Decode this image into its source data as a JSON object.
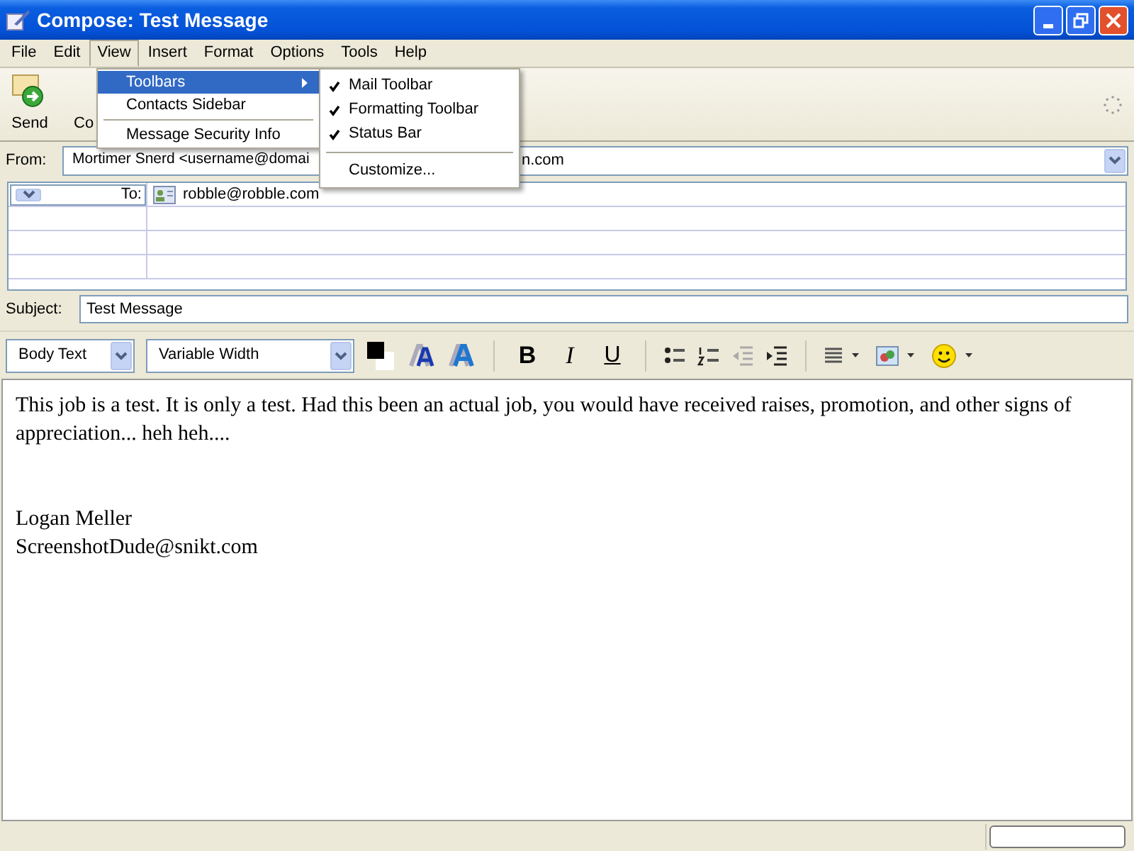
{
  "window": {
    "title": "Compose: Test Message"
  },
  "menu_bar": [
    {
      "label": "File",
      "selected": false
    },
    {
      "label": "Edit",
      "selected": false
    },
    {
      "label": "View",
      "selected": true
    },
    {
      "label": "Insert",
      "selected": false
    },
    {
      "label": "Format",
      "selected": false
    },
    {
      "label": "Options",
      "selected": false
    },
    {
      "label": "Tools",
      "selected": false
    },
    {
      "label": "Help",
      "selected": false
    }
  ],
  "toolbar": [
    {
      "label": "Send",
      "kind": "send"
    },
    {
      "label": "Co",
      "kind": "plain"
    }
  ],
  "view_menu": [
    {
      "label": "Toolbars",
      "selected": true,
      "submenu": true
    },
    {
      "label": "Contacts Sidebar",
      "selected": false,
      "submenu": false
    },
    {
      "kind": "separator"
    },
    {
      "label": "Message Security Info",
      "selected": false,
      "submenu": false
    }
  ],
  "toolbars_submenu": [
    {
      "label": "Mail Toolbar",
      "checked": true
    },
    {
      "label": "Formatting Toolbar",
      "checked": true
    },
    {
      "label": "Status Bar",
      "checked": true
    },
    {
      "kind": "separator"
    },
    {
      "label": "Customize...",
      "checked": false
    }
  ],
  "from": {
    "label": "From:",
    "value_left": "Mortimer Snerd <username@domai",
    "value_right": "n.com"
  },
  "recipients": [
    {
      "type": "To:",
      "address": "robble@robble.com"
    }
  ],
  "subject": {
    "label": "Subject:",
    "value": "Test Message"
  },
  "format_toolbar": {
    "paragraph_style": "Body Text",
    "font": "Variable Width",
    "buttons": [
      {
        "label": "B",
        "kind": "bold"
      },
      {
        "label": "I",
        "kind": "italic"
      },
      {
        "label": "U",
        "kind": "underline"
      }
    ]
  },
  "body": {
    "paragraph": "This job is a test.  It is only a test.  Had this been an actual job, you would have received raises, promotion, and other signs of appreciation... heh heh....",
    "signature": [
      "Logan Meller",
      "ScreenshotDude@snikt.com"
    ]
  }
}
